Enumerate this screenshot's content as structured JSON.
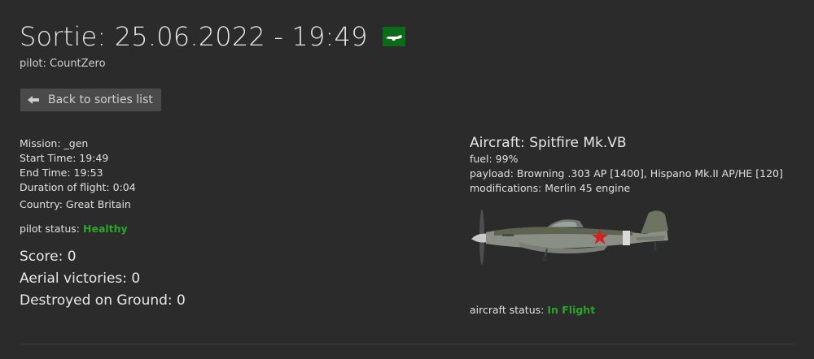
{
  "header": {
    "title": "Sortie: 25.06.2022 - 19:49",
    "pilot_label": "pilot:",
    "pilot_name": "CountZero",
    "type_icon": "aircraft-silhouette-icon",
    "type_badge_color": "#0b6b1a"
  },
  "back_button": {
    "label": "Back to sorties list",
    "icon": "arrow-left-icon"
  },
  "mission_info": {
    "mission": "Mission: _gen",
    "start_time": "Start Time: 19:49",
    "end_time": "End Time: 19:53",
    "duration": "Duration of flight: 0:04",
    "country": "Country: Great Britain"
  },
  "pilot_status": {
    "label": "pilot status:",
    "value": "Healthy",
    "color": "#2aa52a"
  },
  "stats": {
    "score": "Score: 0",
    "aerial_victories": "Aerial victories: 0",
    "destroyed_ground": "Destroyed on Ground: 0"
  },
  "aircraft": {
    "name": "Aircraft: Spitfire Mk.VB",
    "fuel": "fuel: 99%",
    "payload": "payload: Browning .303 AP [1400], Hispano Mk.II AP/HE [120]",
    "modifications": "modifications: Merlin 45 engine",
    "image": "spitfire-aircraft-image",
    "status_label": "aircraft status:",
    "status_value": "In Flight",
    "status_color": "#2aa52a"
  }
}
